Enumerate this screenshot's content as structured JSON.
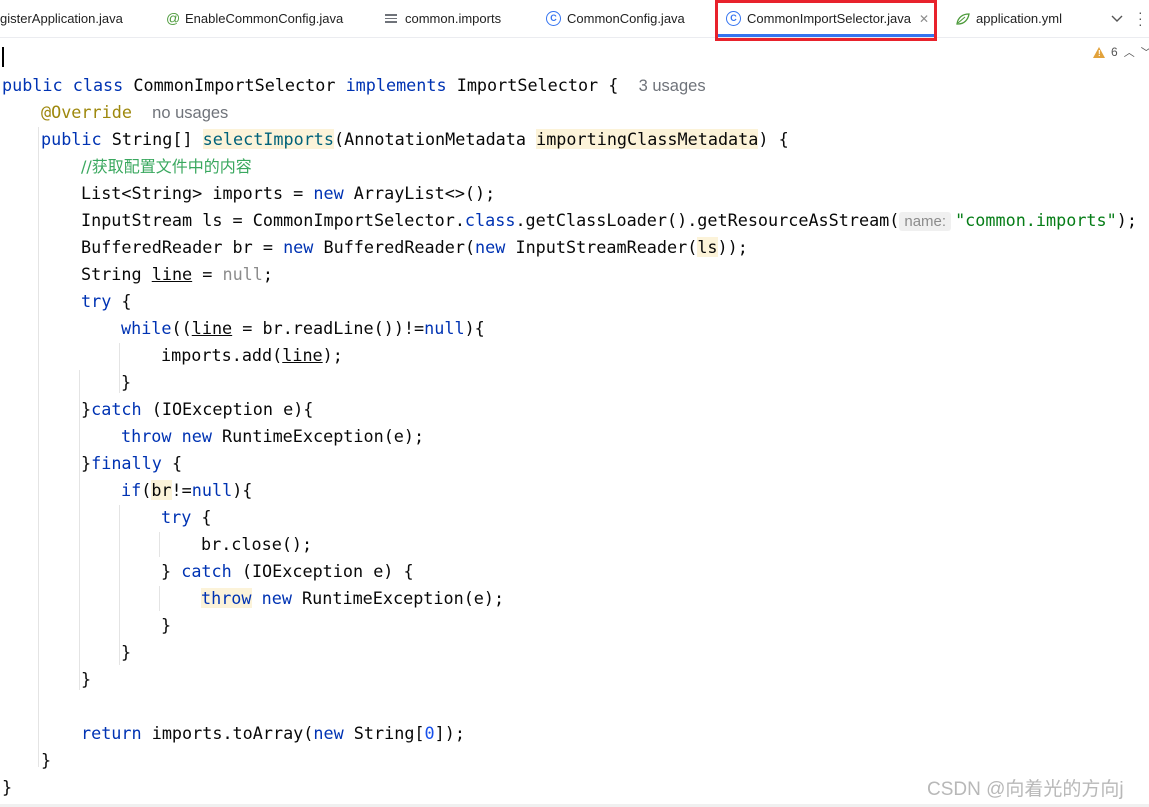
{
  "tabs": [
    {
      "label": "gisterApplication.java"
    },
    {
      "label": "EnableCommonConfig.java"
    },
    {
      "label": "common.imports"
    },
    {
      "label": "CommonConfig.java"
    },
    {
      "label": "CommonImportSelector.java",
      "active": true
    },
    {
      "label": "application.yml"
    }
  ],
  "tab_icons": {
    "annotation": "@",
    "class": "C"
  },
  "warnings": {
    "count": "6"
  },
  "code": {
    "l1_public": "public",
    "l1_class": "class",
    "l1_name": "CommonImportSelector",
    "l1_implements": "implements",
    "l1_iface": "ImportSelector",
    "l1_brace": "{",
    "l1_usages": "3 usages",
    "l2_override": "@Override",
    "l2_usages": "no usages",
    "l3_public": "public",
    "l3_type": "String[]",
    "l3_method": "selectImports",
    "l3_paren": "(AnnotationMetadata",
    "l3_param": "importingClassMetadata",
    "l3_end": ") {",
    "l4_comment": "//获取配置文件中的内容",
    "l5_a": "List<String> imports = ",
    "l5_new": "new",
    "l5_b": " ArrayList<>();",
    "l6_a": "InputStream ls = CommonImportSelector.",
    "l6_class": "class",
    "l6_b": ".getClassLoader().getResourceAsStream(",
    "l6_hint": "name:",
    "l6_str": "\"common.imports\"",
    "l6_end": ");",
    "l7_a": "BufferedReader br = ",
    "l7_new": "new",
    "l7_b": " BufferedReader(",
    "l7_new2": "new",
    "l7_c": " InputStreamReader(",
    "l7_ls": "ls",
    "l7_end": "));",
    "l8_a": "String ",
    "l8_line": "line",
    "l8_b": " = ",
    "l8_null": "null",
    "l8_end": ";",
    "l9_try": "try",
    "l9_end": " {",
    "l10_while": "while",
    "l10_a": "((",
    "l10_line": "line",
    "l10_b": " = br.readLine())!=",
    "l10_null": "null",
    "l10_end": "){",
    "l11_a": "imports.add(",
    "l11_line": "line",
    "l11_end": ");",
    "l12": "}",
    "l13_a": "}",
    "l13_catch": "catch",
    "l13_b": " (IOException e){",
    "l14_throw": "throw",
    "l14_new": "new",
    "l14_b": " RuntimeException(e);",
    "l15_a": "}",
    "l15_finally": "finally",
    "l15_b": " {",
    "l16_if": "if",
    "l16_a": "(",
    "l16_br": "br",
    "l16_b": "!=",
    "l16_null": "null",
    "l16_end": "){",
    "l17_try": "try",
    "l17_end": " {",
    "l18": "br.close();",
    "l19_a": "} ",
    "l19_catch": "catch",
    "l19_b": " (IOException e) {",
    "l20_throw": "throw",
    "l20_new": "new",
    "l20_b": " RuntimeException(e);",
    "l21": "}",
    "l22": "}",
    "l23": "}",
    "l25_return": "return",
    "l25_a": " imports.toArray(",
    "l25_new": "new",
    "l25_b": " String[",
    "l25_zero": "0",
    "l25_end": "]);",
    "l26": "}",
    "l27": "}"
  },
  "watermark": "CSDN @向着光的方向j"
}
